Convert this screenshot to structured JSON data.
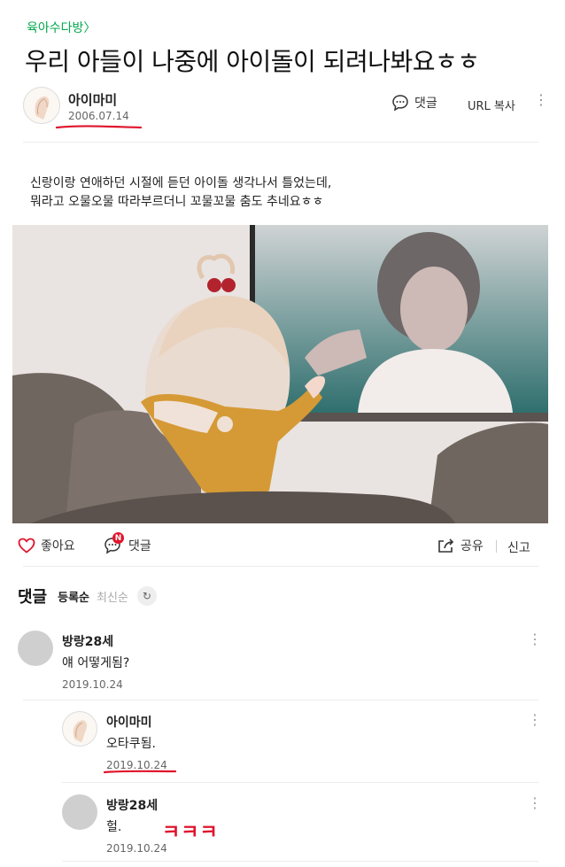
{
  "cafe": {
    "board_link": "육아수다방"
  },
  "post": {
    "title": "우리 아들이 나중에 아이돌이 되려나봐요ㅎㅎ",
    "author": {
      "name": "아이마미",
      "date": "2006.07.14"
    },
    "header_actions": {
      "comment_label": "댓글",
      "url_copy_label": "URL 복사",
      "more": "⋮"
    },
    "body_lines": [
      "신랑이랑 연애하던 시절에 듣던 아이돌 생각나서 틀었는데,",
      "뭐라고 오물오물 따라부르더니 꼬물꼬물 춤도 추네요ㅎㅎ"
    ],
    "actions": {
      "like_label": "좋아요",
      "comment_label": "댓글",
      "new_badge": "N",
      "share_label": "공유",
      "report_label": "신고"
    }
  },
  "comments_section": {
    "title": "댓글",
    "sort_options": [
      "등록순",
      "최신순"
    ],
    "comments": [
      {
        "name": "방랑28세",
        "text": "얘 어떻게됨?",
        "date": "2019.10.24"
      },
      {
        "name": "아이마미",
        "text": "오타쿠됨.",
        "date": "2019.10.24"
      },
      {
        "name": "방랑28세",
        "text": "헐.",
        "date": "2019.10.24"
      }
    ],
    "handwritten_note": "ㅋㅋㅋ"
  },
  "colors": {
    "brand_green": "#03a94d",
    "annotation_red": "#e0142c",
    "like_heart": "#e0142c"
  }
}
